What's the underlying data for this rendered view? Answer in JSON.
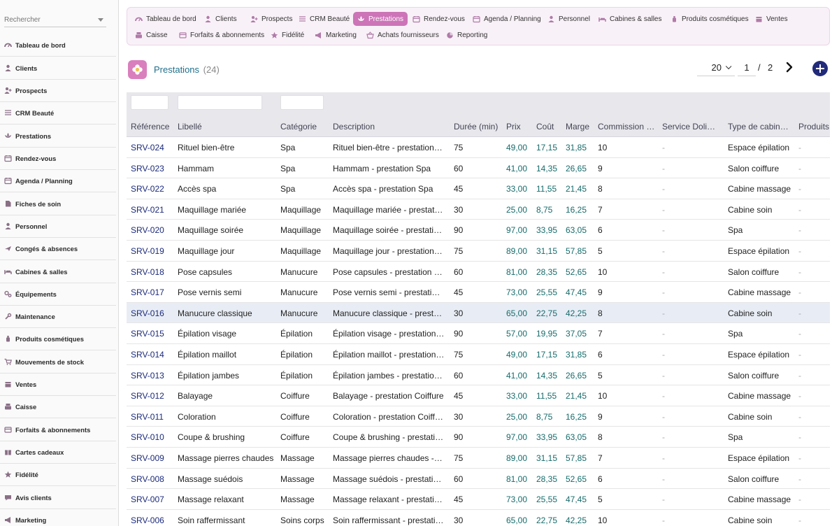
{
  "search": {
    "placeholder": "Rechercher"
  },
  "sidebar": {
    "items": [
      {
        "label": "Tableau de bord",
        "icon": "dashboard-icon"
      },
      {
        "label": "Clients",
        "icon": "user-icon"
      },
      {
        "label": "Prospects",
        "icon": "user-plus-icon"
      },
      {
        "label": "CRM Beauté",
        "icon": "list-icon"
      },
      {
        "label": "Prestations",
        "icon": "lotus-icon"
      },
      {
        "label": "Rendez-vous",
        "icon": "calendar-icon"
      },
      {
        "label": "Agenda / Planning",
        "icon": "calendar-icon"
      },
      {
        "label": "Fiches de soin",
        "icon": "file-icon"
      },
      {
        "label": "Personnel",
        "icon": "user-icon"
      },
      {
        "label": "Congés & absences",
        "icon": "plane-icon"
      },
      {
        "label": "Cabines & salles",
        "icon": "bed-icon"
      },
      {
        "label": "Équipements",
        "icon": "gears-icon"
      },
      {
        "label": "Maintenance",
        "icon": "wrench-icon"
      },
      {
        "label": "Produits cosmétiques",
        "icon": "bottle-icon"
      },
      {
        "label": "Mouvements de stock",
        "icon": "cart-icon"
      },
      {
        "label": "Ventes",
        "icon": "box-icon"
      },
      {
        "label": "Caisse",
        "icon": "cash-register-icon"
      },
      {
        "label": "Forfaits & abonnements",
        "icon": "card-icon"
      },
      {
        "label": "Cartes cadeaux",
        "icon": "gift-icon"
      },
      {
        "label": "Fidélité",
        "icon": "star-icon"
      },
      {
        "label": "Avis clients",
        "icon": "chat-icon"
      },
      {
        "label": "Marketing",
        "icon": "megaphone-icon"
      }
    ]
  },
  "topmenu": {
    "items": [
      {
        "label": "Tableau de bord",
        "icon": "dashboard-icon",
        "active": false
      },
      {
        "label": "Clients",
        "icon": "user-icon",
        "active": false
      },
      {
        "label": "Prospects",
        "icon": "user-plus-icon",
        "active": false
      },
      {
        "label": "CRM Beauté",
        "icon": "list-icon",
        "active": false
      },
      {
        "label": "Prestations",
        "icon": "lotus-icon",
        "active": true
      },
      {
        "label": "Rendez-vous",
        "icon": "calendar-icon",
        "active": false
      },
      {
        "label": "Agenda / Planning",
        "icon": "calendar-icon",
        "active": false
      },
      {
        "label": "Personnel",
        "icon": "user-icon",
        "active": false
      },
      {
        "label": "Cabines & salles",
        "icon": "bed-icon",
        "active": false
      },
      {
        "label": "Produits cosmétiques",
        "icon": "bottle-icon",
        "active": false
      },
      {
        "label": "Ventes",
        "icon": "box-icon",
        "active": false
      },
      {
        "label": "Caisse",
        "icon": "cash-register-icon",
        "active": false
      },
      {
        "label": "Forfaits & abonnements",
        "icon": "card-icon",
        "active": false
      },
      {
        "label": "Fidélité",
        "icon": "star-icon",
        "active": false
      },
      {
        "label": "Marketing",
        "icon": "megaphone-icon",
        "active": false
      },
      {
        "label": "Achats fournisseurs",
        "icon": "basket-icon",
        "active": false
      },
      {
        "label": "Reporting",
        "icon": "pie-chart-icon",
        "active": false
      }
    ]
  },
  "page": {
    "title": "Prestations",
    "count": "(24)",
    "logo_icon": "flower-icon"
  },
  "pagination": {
    "limit": "20",
    "current": "1",
    "separator": "/",
    "total": "2"
  },
  "colors": {
    "accent": "#cc74b7",
    "ref_link": "#1b2a7a",
    "number": "#176b6b"
  },
  "table": {
    "headers": [
      "Référence",
      "Libellé",
      "Catégorie",
      "Description",
      "Durée (min)",
      "Prix",
      "Coût",
      "Marge",
      "Commission …",
      "Service Doli…",
      "Type de cabin…",
      "Produits"
    ],
    "rows": [
      [
        "SRV-024",
        "Rituel bien-être",
        "Spa",
        "Rituel bien-être - prestation Spa",
        "75",
        "49,00",
        "17,15",
        "31,85",
        "10",
        "-",
        "Espace épilation",
        "-"
      ],
      [
        "SRV-023",
        "Hammam",
        "Spa",
        "Hammam - prestation Spa",
        "60",
        "41,00",
        "14,35",
        "26,65",
        "9",
        "-",
        "Salon coiffure",
        "-"
      ],
      [
        "SRV-022",
        "Accès spa",
        "Spa",
        "Accès spa - prestation Spa",
        "45",
        "33,00",
        "11,55",
        "21,45",
        "8",
        "-",
        "Cabine massage",
        "-"
      ],
      [
        "SRV-021",
        "Maquillage mariée",
        "Maquillage",
        "Maquillage mariée - prestation Maquillage",
        "30",
        "25,00",
        "8,75",
        "16,25",
        "7",
        "-",
        "Cabine soin",
        "-"
      ],
      [
        "SRV-020",
        "Maquillage soirée",
        "Maquillage",
        "Maquillage soirée - prestation Maquillage",
        "90",
        "97,00",
        "33,95",
        "63,05",
        "6",
        "-",
        "Spa",
        "-"
      ],
      [
        "SRV-019",
        "Maquillage jour",
        "Maquillage",
        "Maquillage jour - prestation Maquillage",
        "75",
        "89,00",
        "31,15",
        "57,85",
        "5",
        "-",
        "Espace épilation",
        "-"
      ],
      [
        "SRV-018",
        "Pose capsules",
        "Manucure",
        "Pose capsules - prestation Manucure",
        "60",
        "81,00",
        "28,35",
        "52,65",
        "10",
        "-",
        "Salon coiffure",
        "-"
      ],
      [
        "SRV-017",
        "Pose vernis semi",
        "Manucure",
        "Pose vernis semi - prestation Manucure",
        "45",
        "73,00",
        "25,55",
        "47,45",
        "9",
        "-",
        "Cabine massage",
        "-"
      ],
      [
        "SRV-016",
        "Manucure classique",
        "Manucure",
        "Manucure classique - prestation Manucure",
        "30",
        "65,00",
        "22,75",
        "42,25",
        "8",
        "-",
        "Cabine soin",
        "-"
      ],
      [
        "SRV-015",
        "Épilation visage",
        "Épilation",
        "Épilation visage - prestation Épilation",
        "90",
        "57,00",
        "19,95",
        "37,05",
        "7",
        "-",
        "Spa",
        "-"
      ],
      [
        "SRV-014",
        "Épilation maillot",
        "Épilation",
        "Épilation maillot - prestation Épilation",
        "75",
        "49,00",
        "17,15",
        "31,85",
        "6",
        "-",
        "Espace épilation",
        "-"
      ],
      [
        "SRV-013",
        "Épilation jambes",
        "Épilation",
        "Épilation jambes - prestation Épilation",
        "60",
        "41,00",
        "14,35",
        "26,65",
        "5",
        "-",
        "Salon coiffure",
        "-"
      ],
      [
        "SRV-012",
        "Balayage",
        "Coiffure",
        "Balayage - prestation Coiffure",
        "45",
        "33,00",
        "11,55",
        "21,45",
        "10",
        "-",
        "Cabine massage",
        "-"
      ],
      [
        "SRV-011",
        "Coloration",
        "Coiffure",
        "Coloration - prestation Coiffure",
        "30",
        "25,00",
        "8,75",
        "16,25",
        "9",
        "-",
        "Cabine soin",
        "-"
      ],
      [
        "SRV-010",
        "Coupe & brushing",
        "Coiffure",
        "Coupe & brushing - prestation Coiffure",
        "90",
        "97,00",
        "33,95",
        "63,05",
        "8",
        "-",
        "Spa",
        "-"
      ],
      [
        "SRV-009",
        "Massage pierres chaudes",
        "Massage",
        "Massage pierres chaudes - prestation Massage",
        "75",
        "89,00",
        "31,15",
        "57,85",
        "7",
        "-",
        "Espace épilation",
        "-"
      ],
      [
        "SRV-008",
        "Massage suédois",
        "Massage",
        "Massage suédois - prestation Massage",
        "60",
        "81,00",
        "28,35",
        "52,65",
        "6",
        "-",
        "Salon coiffure",
        "-"
      ],
      [
        "SRV-007",
        "Massage relaxant",
        "Massage",
        "Massage relaxant - prestation Massage",
        "45",
        "73,00",
        "25,55",
        "47,45",
        "5",
        "-",
        "Cabine massage",
        "-"
      ],
      [
        "SRV-006",
        "Soin raffermissant",
        "Soins corps",
        "Soin raffermissant - prestation Soins corps",
        "30",
        "65,00",
        "22,75",
        "42,25",
        "10",
        "-",
        "Cabine soin",
        "-"
      ]
    ]
  }
}
